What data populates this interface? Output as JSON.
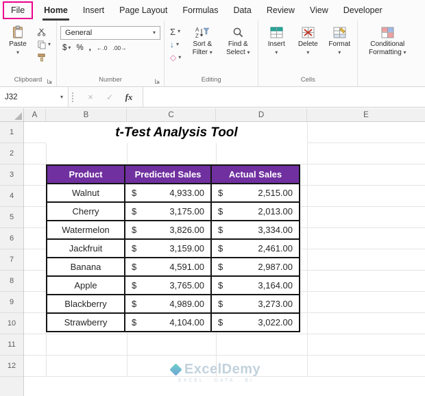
{
  "ribbon": {
    "tabs": [
      {
        "label": "File"
      },
      {
        "label": "Home"
      },
      {
        "label": "Insert"
      },
      {
        "label": "Page Layout"
      },
      {
        "label": "Formulas"
      },
      {
        "label": "Data"
      },
      {
        "label": "Review"
      },
      {
        "label": "View"
      },
      {
        "label": "Developer"
      }
    ],
    "active_tab": "Home",
    "groups": {
      "clipboard": {
        "label": "Clipboard",
        "paste_label": "Paste"
      },
      "number": {
        "label": "Number",
        "format_value": "General"
      },
      "editing": {
        "label": "Editing",
        "sort_filter_label": "Sort & Filter",
        "find_select_label": "Find & Select"
      },
      "cells": {
        "label": "Cells",
        "insert_label": "Insert",
        "delete_label": "Delete",
        "format_label": "Format"
      },
      "styles": {
        "conditional_formatting_label": "Conditional Formatting"
      }
    }
  },
  "glyphs": {
    "dropdown": "▾",
    "autosum": "Σ",
    "fill": "↓",
    "clear": "◇",
    "dollar": "$",
    "percent": "%",
    "comma": ",",
    "increase_decimal": "←.0",
    "decrease_decimal": ".00→",
    "cancel": "×",
    "enter": "✓",
    "function": "fx"
  },
  "formula_bar": {
    "name_box": "J32",
    "formula_value": ""
  },
  "grid": {
    "column_headers": [
      "A",
      "B",
      "C",
      "D",
      "E"
    ],
    "row_headers": [
      "1",
      "2",
      "3",
      "4",
      "5",
      "6",
      "7",
      "8",
      "9",
      "10",
      "11",
      "12"
    ]
  },
  "sheet": {
    "title": "t-Test Analysis Tool",
    "currency_symbol": "$",
    "table": {
      "headers": [
        "Product",
        "Predicted Sales",
        "Actual Sales"
      ],
      "rows": [
        {
          "product": "Walnut",
          "predicted": "4,933.00",
          "actual": "2,515.00"
        },
        {
          "product": "Cherry",
          "predicted": "3,175.00",
          "actual": "2,013.00"
        },
        {
          "product": "Watermelon",
          "predicted": "3,826.00",
          "actual": "3,334.00"
        },
        {
          "product": "Jackfruit",
          "predicted": "3,159.00",
          "actual": "2,461.00"
        },
        {
          "product": "Banana",
          "predicted": "4,591.00",
          "actual": "2,987.00"
        },
        {
          "product": "Apple",
          "predicted": "3,765.00",
          "actual": "3,164.00"
        },
        {
          "product": "Blackberry",
          "predicted": "4,989.00",
          "actual": "3,273.00"
        },
        {
          "product": "Strawberry",
          "predicted": "4,104.00",
          "actual": "3,022.00"
        }
      ]
    },
    "watermark": {
      "name": "ExcelDemy",
      "tagline": "EXCEL · DATA · BI"
    }
  },
  "colors": {
    "table_header_bg": "#7030A0",
    "file_highlight": "#EC008C",
    "active_tab_underline": "#3c3c3c"
  }
}
